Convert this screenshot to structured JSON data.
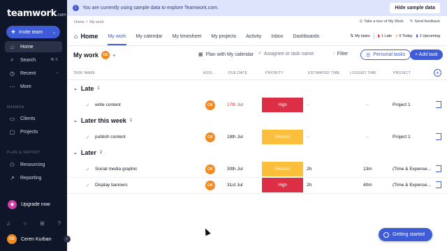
{
  "app": {
    "logo": "teamwork",
    "logo_suffix": ".com"
  },
  "sidebar": {
    "invite": "Invite team",
    "nav": [
      {
        "label": "Home",
        "icon": "home-icon",
        "active": true
      },
      {
        "label": "Search",
        "icon": "search-icon",
        "kbd": "⌘ K"
      },
      {
        "label": "Recent",
        "icon": "clock-icon",
        "chev": "›"
      },
      {
        "label": "More",
        "icon": "more-icon"
      }
    ],
    "manage_label": "Manage",
    "manage": [
      {
        "label": "Clients",
        "icon": "clients-icon"
      },
      {
        "label": "Projects",
        "icon": "folder-icon"
      }
    ],
    "plan_label": "Plan & Report",
    "plan": [
      {
        "label": "Resourcing",
        "icon": "resourcing-icon"
      },
      {
        "label": "Reporting",
        "icon": "reporting-icon"
      }
    ],
    "upgrade": "Upgrade now",
    "user": {
      "name": "Ceren Kurban",
      "initials": "CK"
    }
  },
  "banner": {
    "text": "You are currently using sample data to explore Teamwork.com.",
    "hide": "Hide sample data"
  },
  "breadcrumb": [
    "Home",
    "/",
    "My work"
  ],
  "top_links": {
    "tour": "Take a tour of My Work",
    "feedback": "Send feedback"
  },
  "header": {
    "title": "Home",
    "tabs": [
      "My work",
      "My calendar",
      "My timesheet",
      "My projects",
      "Activity",
      "Inbox",
      "Dashboards"
    ]
  },
  "counts": {
    "my_tasks": "My tasks",
    "late": "1 Late",
    "today": "0 Today",
    "upcoming": "1 Upcoming",
    "late_color": "#dc2626",
    "today_color": "#f59e0b",
    "upcoming_color": "#3e5bd8"
  },
  "toolbar": {
    "title": "My work",
    "initials": "CK",
    "plus": "+",
    "plan_calendar": "Plan with My calendar",
    "search_placeholder": "Assignee or task name",
    "filter": "Filter",
    "personal": "Personal tasks",
    "add_task": "+ Add task"
  },
  "columns": [
    "Task name",
    "Assi...",
    "Due date",
    "Priority",
    "Estimated time",
    "Logged time",
    "Project"
  ],
  "groups": [
    {
      "name": "Late",
      "count": "1",
      "tasks": [
        {
          "name": "write content",
          "assignee": "CK",
          "due": "17th Jul",
          "overdue": true,
          "priority": "High",
          "priority_level": "high",
          "est": "--",
          "logged": "--",
          "project": "Project 1"
        }
      ]
    },
    {
      "name": "Later this week",
      "count": "1",
      "tasks": [
        {
          "name": "publish content",
          "assignee": "CK",
          "due": "18th Jul",
          "overdue": false,
          "priority": "Medium",
          "priority_level": "medium",
          "est": "--",
          "logged": "--",
          "project": "Project 1"
        }
      ]
    },
    {
      "name": "Later",
      "count": "2",
      "tasks": [
        {
          "name": "Social media graphic",
          "assignee": "CK",
          "due": "30th Jul",
          "overdue": false,
          "priority": "Medium",
          "priority_level": "medium",
          "est": "2h",
          "logged": "13m",
          "project": "(Time & Expense..."
        },
        {
          "name": "Display banners",
          "assignee": "CK",
          "due": "31st Jul",
          "overdue": false,
          "priority": "High",
          "priority_level": "high",
          "est": "2h",
          "logged": "40m",
          "project": "(Time & Expense..."
        }
      ]
    }
  ],
  "getting_started": "Getting started",
  "colors": {
    "accent": "#3e5bd8",
    "sidebar": "#0f1629",
    "high": "#dc2e44",
    "medium": "#fbbf3c"
  }
}
